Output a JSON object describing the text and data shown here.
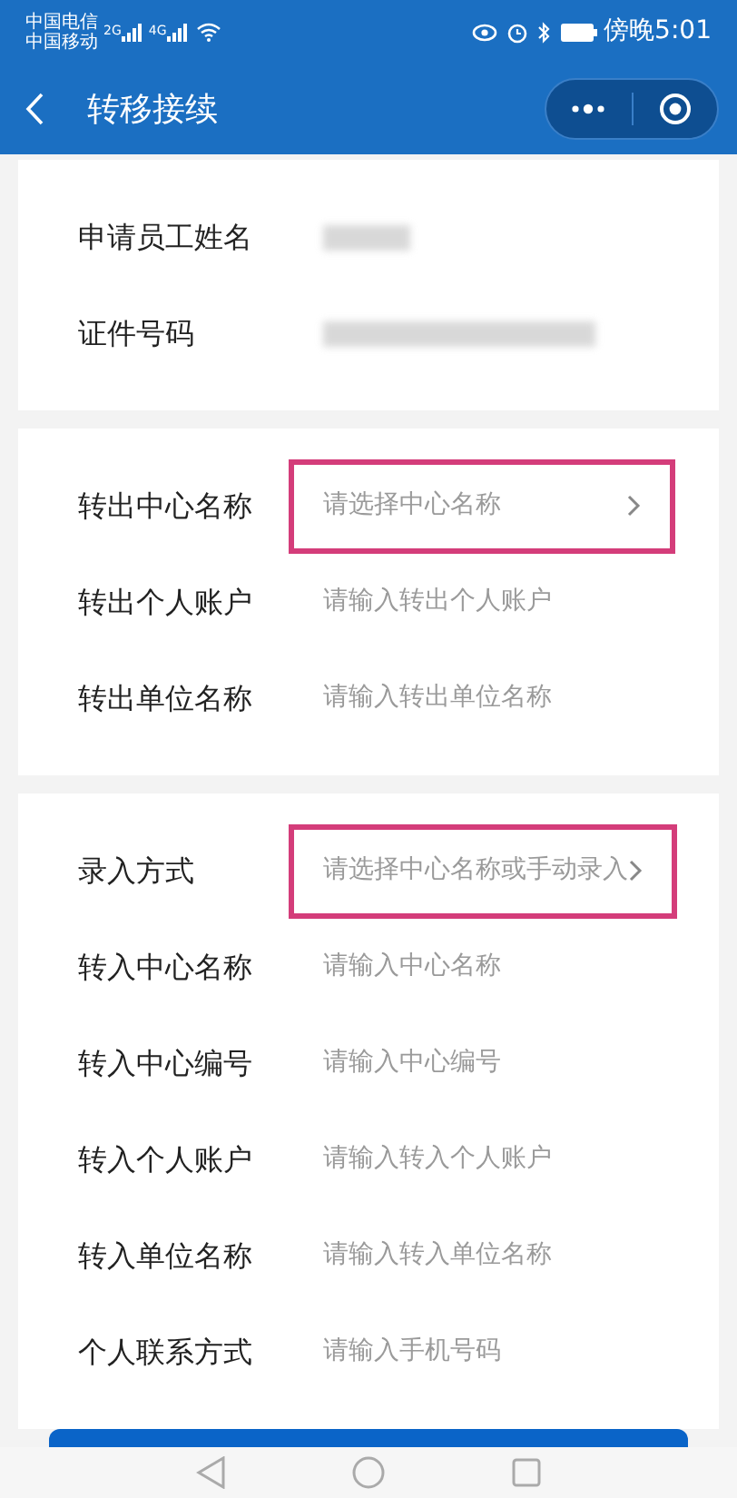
{
  "status_bar": {
    "carriers": [
      "中国电信",
      "中国移动"
    ],
    "networks": [
      "2G",
      "4G"
    ],
    "time": "傍晚5:01"
  },
  "header": {
    "title": "转移接续"
  },
  "sections": [
    {
      "rows": [
        {
          "label": "申请员工姓名",
          "kind": "masked",
          "highlighted": false
        },
        {
          "label": "证件号码",
          "kind": "masked",
          "highlighted": false
        }
      ]
    },
    {
      "rows": [
        {
          "label": "转出中心名称",
          "kind": "select",
          "placeholder": "请选择中心名称",
          "highlighted": true
        },
        {
          "label": "转出个人账户",
          "kind": "input",
          "placeholder": "请输入转出个人账户",
          "highlighted": false
        },
        {
          "label": "转出单位名称",
          "kind": "input",
          "placeholder": "请输入转出单位名称",
          "highlighted": false
        }
      ]
    },
    {
      "rows": [
        {
          "label": "录入方式",
          "kind": "select",
          "placeholder": "请选择中心名称或手动录入",
          "highlighted": true
        },
        {
          "label": "转入中心名称",
          "kind": "input",
          "placeholder": "请输入中心名称",
          "highlighted": false
        },
        {
          "label": "转入中心编号",
          "kind": "input",
          "placeholder": "请输入中心编号",
          "highlighted": false
        },
        {
          "label": "转入个人账户",
          "kind": "input",
          "placeholder": "请输入转入个人账户",
          "highlighted": false
        },
        {
          "label": "转入单位名称",
          "kind": "input",
          "placeholder": "请输入转入单位名称",
          "highlighted": false
        },
        {
          "label": "个人联系方式",
          "kind": "input",
          "placeholder": "请输入手机号码",
          "highlighted": false
        }
      ]
    }
  ]
}
